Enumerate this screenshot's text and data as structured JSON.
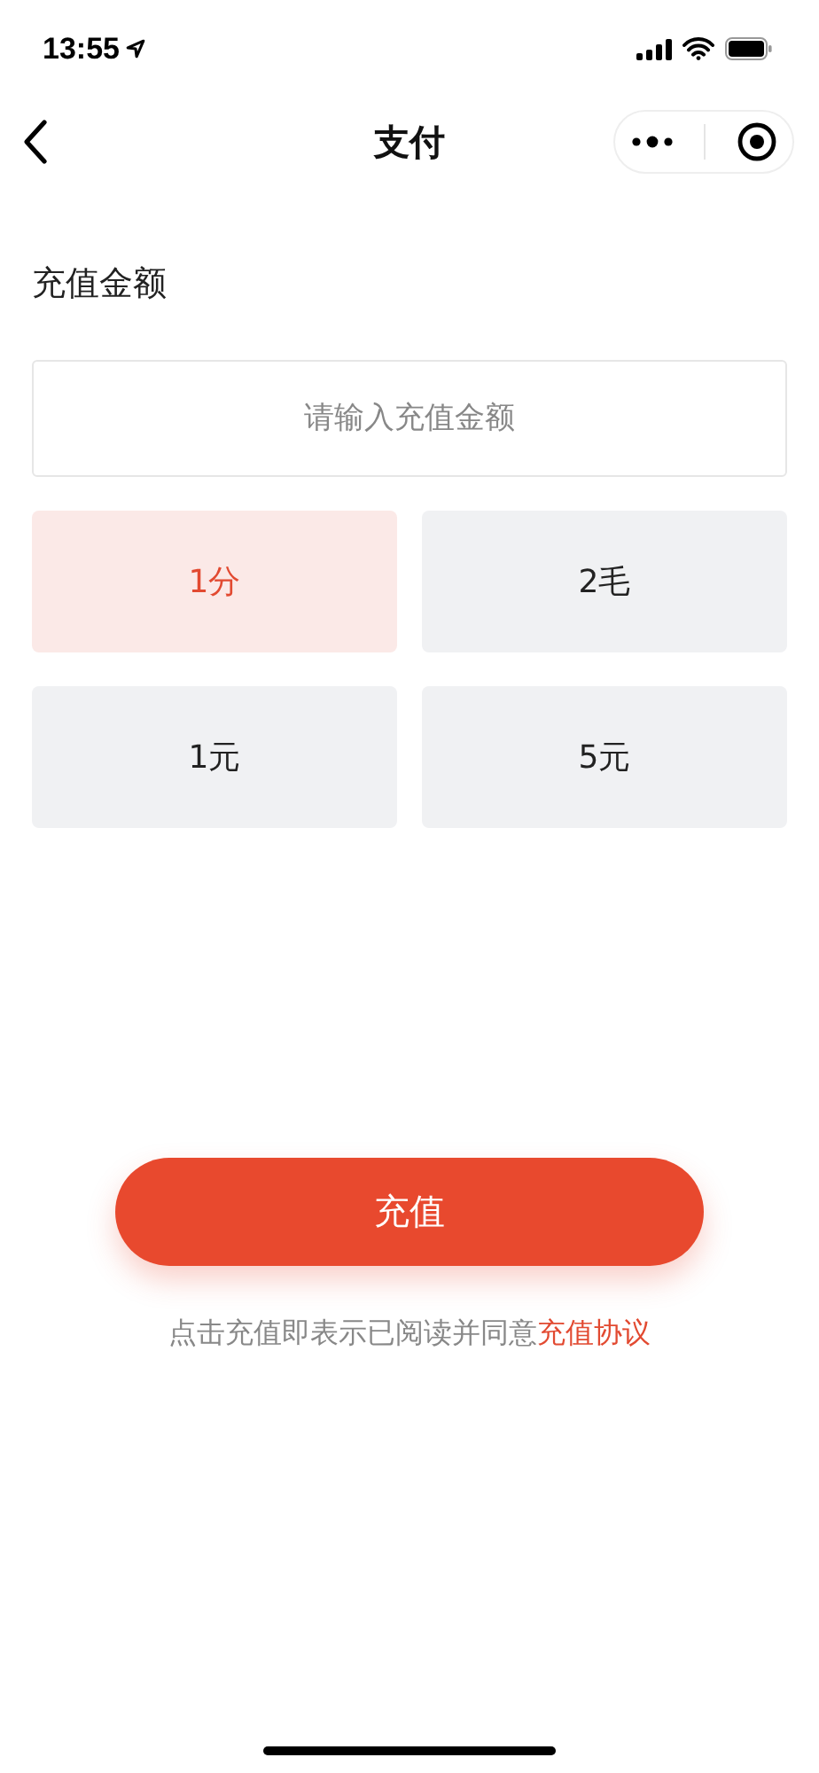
{
  "status_bar": {
    "time": "13:55"
  },
  "nav": {
    "title": "支付"
  },
  "amount": {
    "label": "充值金额",
    "placeholder": "请输入充值金额"
  },
  "options": [
    {
      "label": "1分",
      "selected": true
    },
    {
      "label": "2毛",
      "selected": false
    },
    {
      "label": "1元",
      "selected": false
    },
    {
      "label": "5元",
      "selected": false
    }
  ],
  "submit": "充值",
  "agreement": {
    "text": "点击充值即表示已阅读并同意",
    "link": "充值协议"
  }
}
